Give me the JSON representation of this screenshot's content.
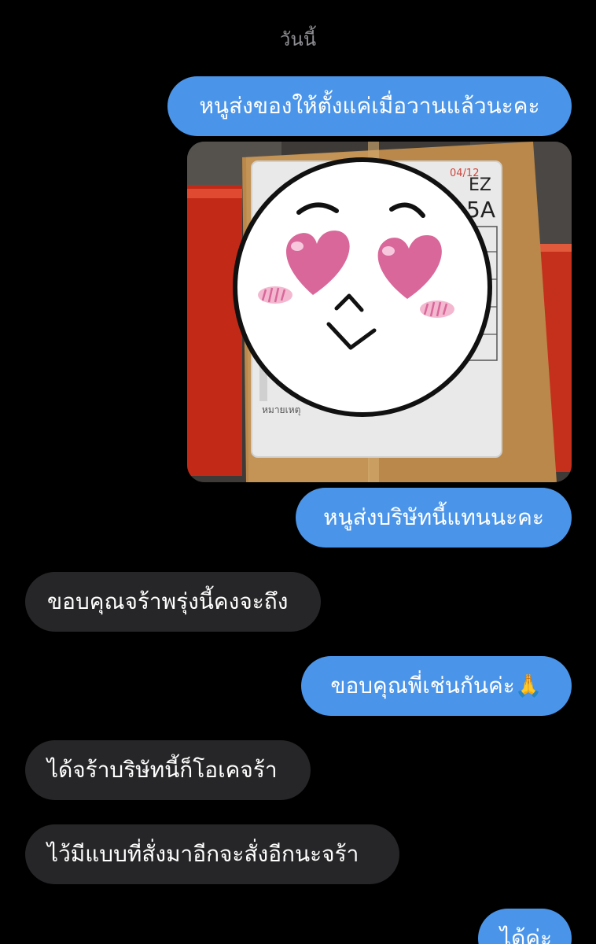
{
  "chat": {
    "date_label": "วันนี้",
    "messages": [
      {
        "dir": "out",
        "type": "text",
        "text": "หนูส่งของให้ตั้งแค่เมื่อวานแล้วนะคะ"
      },
      {
        "dir": "out",
        "type": "image",
        "label_text": [
          "หมายเหตุ"
        ],
        "sticker": "heart-eyes-face"
      },
      {
        "dir": "out",
        "type": "text",
        "text": "หนูส่งบริษัทนี้แทนนะคะ"
      },
      {
        "dir": "in",
        "type": "text",
        "text": "ขอบคุณจร้าพรุ่งนี้คงจะถึง"
      },
      {
        "dir": "out",
        "type": "text",
        "text": "ขอบคุณพี่เช่นกันค่ะ",
        "emoji": "🙏"
      },
      {
        "dir": "in",
        "type": "text",
        "text": "ได้จร้าบริษัทนี้ก็โอเคจร้า"
      },
      {
        "dir": "in",
        "type": "text",
        "text": "ไว้มีแบบที่สั่งมาอีกจะสั่งอีกนะจร้า"
      },
      {
        "dir": "out",
        "type": "text",
        "text": "ได้ค่ะ"
      }
    ]
  },
  "colors": {
    "background": "#000000",
    "outgoing_bubble": "#4a95e9",
    "incoming_bubble": "#262628",
    "date_label": "#8e8e93"
  }
}
